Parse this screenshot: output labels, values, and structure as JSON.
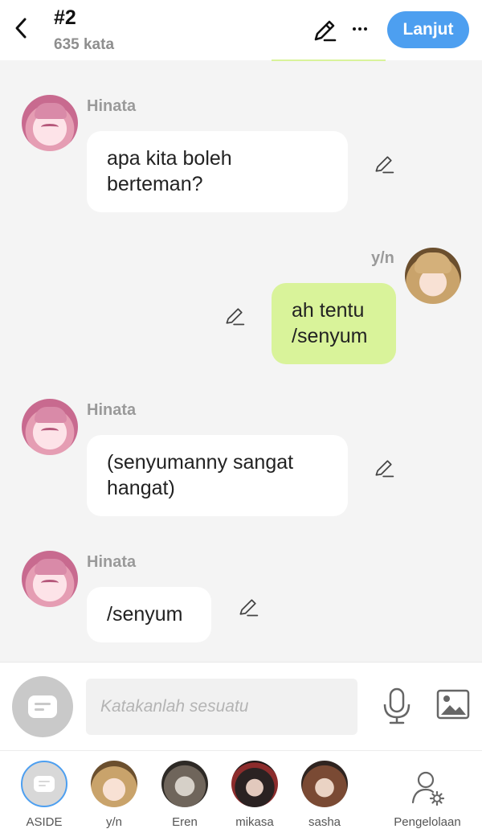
{
  "header": {
    "title": "#2",
    "word_count": "635 kata",
    "next_label": "Lanjut"
  },
  "messages": [
    {
      "sender": "Hinata",
      "text_lines": [
        "apa kita boleh",
        "berteman?"
      ],
      "side": "left"
    },
    {
      "sender": "y/n",
      "text_lines": [
        "ah tentu",
        "/senyum"
      ],
      "side": "right"
    },
    {
      "sender": "Hinata",
      "text_lines": [
        "(senyumanny sangat",
        "hangat)"
      ],
      "side": "left"
    },
    {
      "sender": "Hinata",
      "text_lines": [
        "/senyum"
      ],
      "side": "left"
    }
  ],
  "composer": {
    "placeholder": "Katakanlah sesuatu",
    "value": ""
  },
  "characters": [
    {
      "label": "ASIDE",
      "selected": true
    },
    {
      "label": "y/n"
    },
    {
      "label": "Eren"
    },
    {
      "label": "mikasa"
    },
    {
      "label": "sasha"
    }
  ],
  "manage_label": "Pengelolaan",
  "colors": {
    "accent": "#4d9ff0",
    "bubble_right": "#d9f39a",
    "bubble_left": "#ffffff",
    "background": "#f4f4f4"
  }
}
